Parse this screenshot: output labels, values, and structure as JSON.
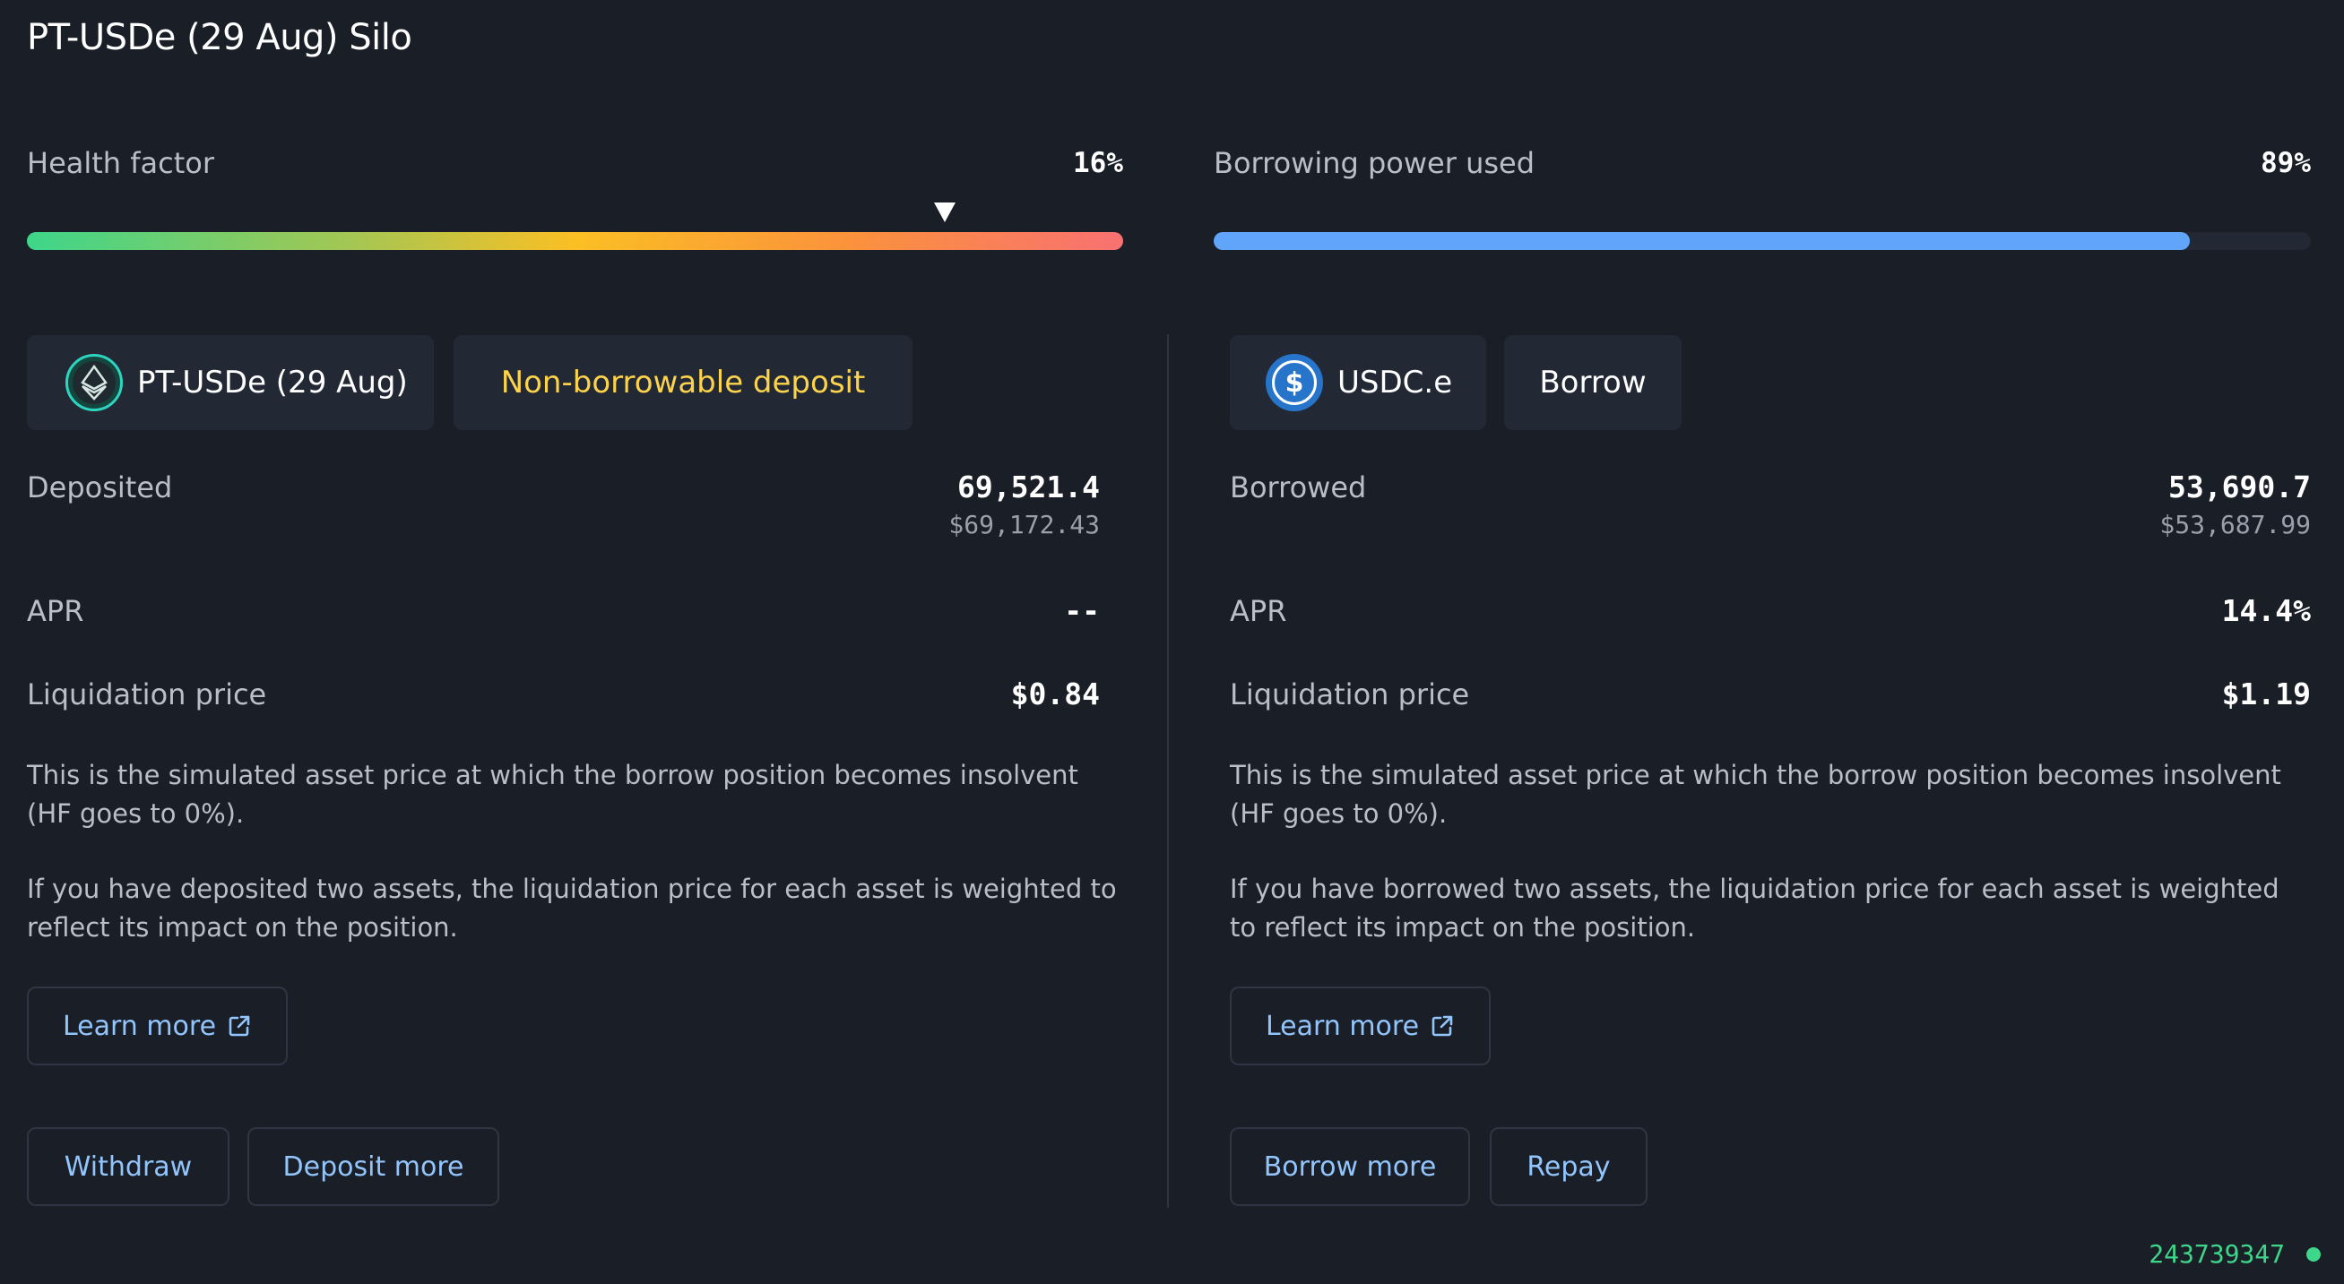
{
  "title": "PT-USDe (29 Aug) Silo",
  "health": {
    "label": "Health factor",
    "value_text": "16%",
    "marker_fraction": 0.837
  },
  "borrowing_power": {
    "label": "Borrowing power used",
    "value_text": "89%",
    "fill_fraction": 0.89,
    "fill_color": "#60a5fa"
  },
  "left": {
    "asset_name": "PT-USDe (29 Aug)",
    "asset_icon": "pt-usde-token-icon",
    "status_chip": "Non-borrowable deposit",
    "status_color": "#fcd34d",
    "deposited_label": "Deposited",
    "deposited_amount": "69,521.4",
    "deposited_usd": "$69,172.43",
    "apr_label": "APR",
    "apr_value": "--",
    "liq_label": "Liquidation price",
    "liq_value": "$0.84",
    "desc1": "This is the simulated asset price at which the borrow position becomes insolvent (HF goes to 0%).",
    "desc2": "If you have deposited two assets, the liquidation price for each asset is weighted to reflect its impact on the position.",
    "learn_more": "Learn more",
    "action1": "Withdraw",
    "action2": "Deposit more"
  },
  "right": {
    "asset_name": "USDC.e",
    "asset_icon": "usdc-token-icon",
    "status_chip": "Borrow",
    "borrowed_label": "Borrowed",
    "borrowed_amount": "53,690.7",
    "borrowed_usd": "$53,687.99",
    "apr_label": "APR",
    "apr_value": "14.4%",
    "liq_label": "Liquidation price",
    "liq_value": "$1.19",
    "desc1": "This is the simulated asset price at which the borrow position becomes insolvent (HF goes to 0%).",
    "desc2": "If you have borrowed two assets, the liquidation price for each asset is weighted to reflect its impact on the position.",
    "learn_more": "Learn more",
    "action1": "Borrow more",
    "action2": "Repay"
  },
  "footer": {
    "block_number": "243739347",
    "status_color": "#3ed68a"
  }
}
